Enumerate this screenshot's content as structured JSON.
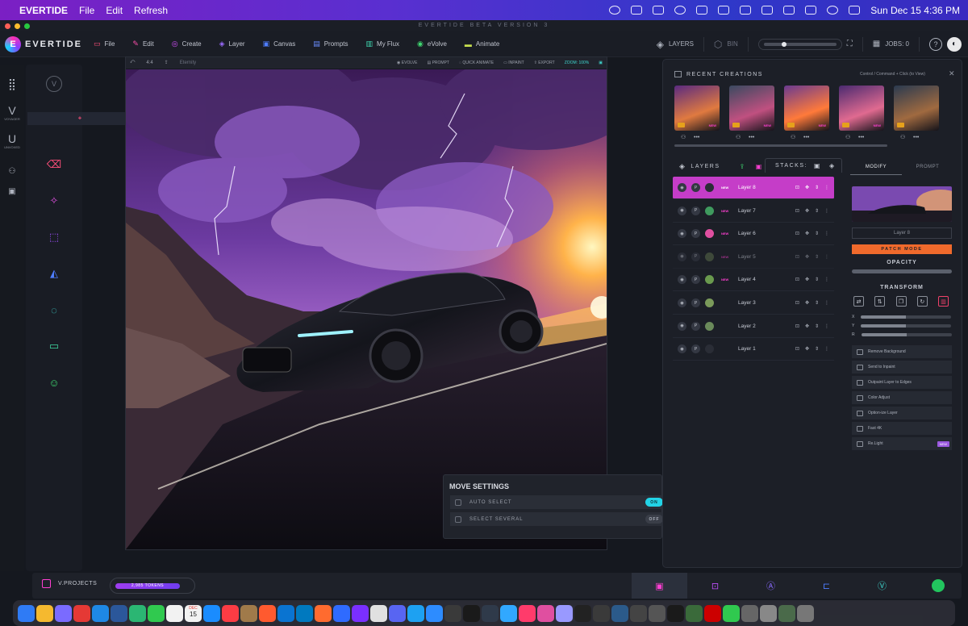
{
  "macos": {
    "apple": "",
    "app_name": "EVERTIDE",
    "menus": [
      "File",
      "Edit",
      "Refresh"
    ],
    "clock": "Sun Dec 15  4:36 PM"
  },
  "window": {
    "title": "EVERTIDE BETA VERSION 3"
  },
  "app": {
    "logo_letter": "E",
    "logo_text": "EVERTIDE",
    "menu": [
      {
        "label": "File",
        "icon": "file-icon",
        "color": "#ff4f7a",
        "glyph": "▭"
      },
      {
        "label": "Edit",
        "icon": "pencil-icon",
        "color": "#ff4fae",
        "glyph": "✎"
      },
      {
        "label": "Create",
        "icon": "create-icon",
        "color": "#d64fff",
        "glyph": "◎"
      },
      {
        "label": "Layer",
        "icon": "layer-icon",
        "color": "#9b6bff",
        "glyph": "◈"
      },
      {
        "label": "Canvas",
        "icon": "canvas-icon",
        "color": "#4f7dff",
        "glyph": "▣"
      },
      {
        "label": "Prompts",
        "icon": "prompt-icon",
        "color": "#6a8dff",
        "glyph": "▤"
      },
      {
        "label": "My Flux",
        "icon": "flux-icon",
        "color": "#3fd8b0",
        "glyph": "▥"
      },
      {
        "label": "eVolve",
        "icon": "evolve-icon",
        "color": "#3fd870",
        "glyph": "◉"
      },
      {
        "label": "Animate",
        "icon": "animate-icon",
        "color": "#c8e04f",
        "glyph": "▬"
      }
    ],
    "layers_label": "LAYERS",
    "bin_label": "BIN",
    "jobs_label": "JOBS: 0",
    "help": "?"
  },
  "rail": {
    "voyager": "VOYAGER",
    "unvoxed": "UNVOXED"
  },
  "canvas": {
    "ratio": "4:4",
    "name": "Eternity",
    "actions": [
      "EVOLVE",
      "PROMPT",
      "QUICK ANIMATE",
      "INPAINT",
      "EXPORT"
    ],
    "zoom": "ZOOM: 100%"
  },
  "move_settings": {
    "title": "MOVE SETTINGS",
    "auto_select": "AUTO SELECT",
    "auto_select_state": "ON",
    "select_several": "SELECT SEVERAL",
    "select_several_state": "OFF"
  },
  "recent": {
    "title": "RECENT CREATIONS",
    "hint": "Control / Command + Click (to View)",
    "close": "✕",
    "thumbs": [
      {
        "badge": "NEW"
      },
      {
        "badge": "NEW"
      },
      {
        "badge": "NEW"
      },
      {
        "badge": "NEW"
      },
      {
        "badge": ""
      }
    ]
  },
  "layers": {
    "title": "LAYERS",
    "stacks": "STACKS:",
    "p": "P",
    "new": "NEW",
    "rows": [
      {
        "name": "Layer 8",
        "new": true,
        "selected": true,
        "color": "#2a2d36"
      },
      {
        "name": "Layer 7",
        "new": true,
        "selected": false,
        "color": "#3f9a5e"
      },
      {
        "name": "Layer 6",
        "new": true,
        "selected": false,
        "color": "#e04fa0"
      },
      {
        "name": "Layer 5",
        "new": true,
        "selected": false,
        "color": "#5a6d4a"
      },
      {
        "name": "Layer 4",
        "new": true,
        "selected": false,
        "color": "#6a9a4e"
      },
      {
        "name": "Layer 3",
        "new": false,
        "selected": false,
        "color": "#7a9a5a"
      },
      {
        "name": "Layer 2",
        "new": false,
        "selected": false,
        "color": "#6a8a5a"
      },
      {
        "name": "Layer 1",
        "new": false,
        "selected": false,
        "color": "#2a2d36"
      }
    ]
  },
  "modify": {
    "tab_modify": "MODIFY",
    "tab_prompt": "PROMPT",
    "layer_name": "Layer 8",
    "patch_mode": "PATCH MODE",
    "opacity": "OPACITY",
    "transform": "TRANSFORM",
    "x": "X",
    "y": "Y",
    "r": "R",
    "actions": [
      {
        "label": "Remove Background",
        "new": false
      },
      {
        "label": "Send to Inpaint",
        "new": false
      },
      {
        "label": "Outpaint Layer to Edges",
        "new": false
      },
      {
        "label": "Color Adjust",
        "new": false
      },
      {
        "label": "Option-ize Layer",
        "new": false
      },
      {
        "label": "Fast 4K",
        "new": false
      },
      {
        "label": "Re.Light",
        "new": true
      }
    ],
    "new_badge": "NEW"
  },
  "bottom": {
    "projects": "V.PROJECTS",
    "tokens": "2,985 TOKENS"
  },
  "colors": {
    "accent_magenta": "#c53dc8",
    "accent_orange": "#f06a2c",
    "toggle_on": "#22d3e6"
  },
  "dock": {
    "calendar_month": "DEC",
    "calendar_day": "15"
  }
}
